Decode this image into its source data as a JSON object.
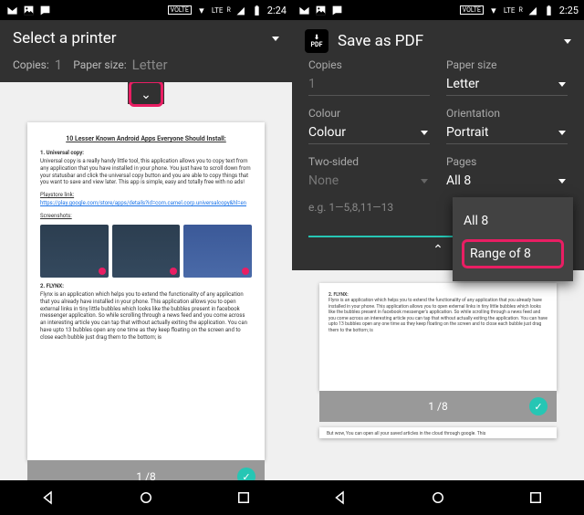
{
  "left": {
    "status": {
      "time": "2:24",
      "volte": "VOLTE",
      "net": "LTE",
      "r": "R"
    },
    "title": "Select a printer",
    "copies_label": "Copies:",
    "copies_value": "1",
    "papersize_label": "Paper size:",
    "papersize_value": "Letter",
    "page_indicator": "1 /8",
    "doc": {
      "title": "10 Lesser Known Android Apps Everyone Should Install:",
      "sec1_head": "1.  Universal copy:",
      "sec1_body": "Universal copy is a really handy little tool, this application allows you to copy text from any application that you have installed in your phone. You just have to scroll down from your statusbar and click the universal copy button and you are able to copy things that you want to save and view later. This app is simple, easy and totally free with no ads!",
      "link_label": "Playstore link:",
      "link_url": "https://play.google.com/store/apps/details?id=com.camel.corp.universalcopy&hl=en",
      "shots": "Screenshots:",
      "sec2_head": "2.  FLYNX:",
      "sec2_body": "Flynx is an application which helps you to extend the functionality of any application that you already have installed in your phone. This application allows you to open external links in tiny little bubbles which looks like the bubbles present in facebook messenger application. So while scrolling through a news feed and you come across an interesting article you can tap that without actually exiting the application. You can have upto 13 bubbles open any one time as they keep floating on the screen and to close each bubble just drag them to the bottom; is"
    }
  },
  "right": {
    "status": {
      "time": "2:25",
      "volte": "VOLTE",
      "net": "LTE",
      "r": "R"
    },
    "pdf_label": "PDF",
    "title": "Save as PDF",
    "copies_label": "Copies",
    "copies_value": "1",
    "papersize_label": "Paper size",
    "papersize_value": "Letter",
    "colour_label": "Colour",
    "colour_value": "Colour",
    "orientation_label": "Orientation",
    "orientation_value": "Portrait",
    "twosided_label": "Two-sided",
    "twosided_value": "None",
    "pages_label": "Pages",
    "pages_value": "All 8",
    "range_hint": "e.g. 1—5,8,11—13",
    "popup_all": "All 8",
    "popup_range": "Range of 8",
    "page_indicator": "1 /8",
    "doc2": {
      "head": "2.  FLYNX:",
      "body": "Flynx is an application which helps you to extend the functionality of any application that you already have installed in your phone. This application allows you to open external links in tiny little bubbles which looks like the bubbles present in facebook messenger's application. So while scrolling through a news feed and you come across an interesting article you can tap that without actually exiting the application. You can have upto 13 bubbles open any one time as they keep floating on the screen and to close each bubble just drag them to the bottom; is",
      "next": "But wow, You can open all your saved articles in the cloud through google. This"
    }
  }
}
